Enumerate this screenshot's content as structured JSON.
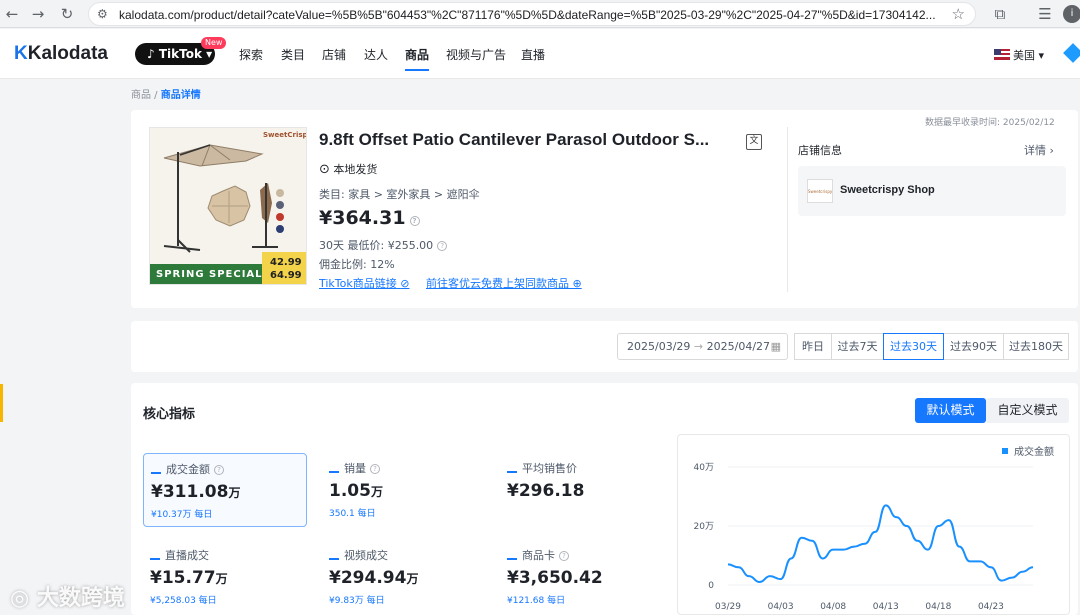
{
  "browser": {
    "url": "kalodata.com/product/detail?cateValue=%5B%5B\"604453\"%2C\"871176\"%5D%5D&dateRange=%5B\"2025-03-29\"%2C\"2025-04-27\"%5D&id=17304142...",
    "profile_initial": "i"
  },
  "nav": {
    "logo": "Kalodata",
    "platform": "TikTok",
    "new_badge": "New",
    "items": [
      "探索",
      "类目",
      "店铺",
      "达人",
      "商品",
      "视频与广告",
      "直播"
    ],
    "active": "商品",
    "region": "美国"
  },
  "breadcrumb": {
    "root": "商品",
    "sep": " / ",
    "current": "商品详情"
  },
  "product": {
    "title": "9.8ft Offset Patio Cantilever Parasol Outdoor S...",
    "ship_from": "本地发货",
    "category": "类目: 家具 > 室外家具 > 遮阳伞",
    "price": "¥364.31",
    "low_price": "30天 最低价: ¥255.00",
    "commission": "佣金比例: 12%",
    "link_tiktok": "TikTok商品链接",
    "link_list": "前往客优云免费上架同款商品",
    "image_banner": "SPRING SPECIAL",
    "image_price_1": "42.99",
    "image_price_2": "64.99",
    "image_brand": "SweetCrispy"
  },
  "shop": {
    "first_recorded": "数据最早收录时间: 2025/02/12",
    "section_title": "店铺信息",
    "details_link": "详情",
    "name": "Sweetcrispy Shop",
    "logo_text": "Sweetcrispy"
  },
  "date_filter": {
    "start": "2025/03/29",
    "arrow": "→",
    "end": "2025/04/27",
    "options": [
      "昨日",
      "过去7天",
      "过去30天",
      "过去90天",
      "过去180天"
    ],
    "active": "过去30天"
  },
  "core": {
    "title": "核心指标",
    "mode_default": "默认模式",
    "mode_custom": "自定义模式",
    "metrics": [
      {
        "label": "成交金额",
        "value": "¥311.08",
        "unit": "万",
        "sub": "¥10.37万 每日"
      },
      {
        "label": "销量",
        "value": "1.05",
        "unit": "万",
        "sub": "350.1 每日"
      },
      {
        "label": "平均销售价",
        "value": "¥296.18",
        "unit": "",
        "sub": ""
      },
      {
        "label": "直播成交",
        "value": "¥15.77",
        "unit": "万",
        "sub": "¥5,258.03 每日"
      },
      {
        "label": "视频成交",
        "value": "¥294.94",
        "unit": "万",
        "sub": "¥9.83万 每日"
      },
      {
        "label": "商品卡",
        "value": "¥3,650.42",
        "unit": "",
        "sub": "¥121.68 每日"
      }
    ]
  },
  "chart_data": {
    "type": "line",
    "series": [
      {
        "name": "成交金额",
        "color": "#1890ff"
      }
    ],
    "x": [
      "03/29",
      "03/30",
      "03/31",
      "04/01",
      "04/02",
      "04/03",
      "04/04",
      "04/05",
      "04/06",
      "04/07",
      "04/08",
      "04/09",
      "04/10",
      "04/11",
      "04/12",
      "04/13",
      "04/14",
      "04/15",
      "04/16",
      "04/17",
      "04/18",
      "04/19",
      "04/20",
      "04/21",
      "04/22",
      "04/23",
      "04/24",
      "04/25",
      "04/26",
      "04/27"
    ],
    "values": [
      7,
      6,
      3,
      1,
      3,
      2,
      9,
      16,
      15,
      9,
      12,
      12,
      13,
      14,
      18,
      27,
      23,
      20,
      15,
      12,
      20,
      22,
      13,
      8,
      8,
      6,
      1.5,
      2.5,
      4.5,
      6
    ],
    "y_ticks": [
      "40万",
      "20万",
      "0"
    ],
    "x_ticks": [
      "03/29",
      "04/03",
      "04/08",
      "04/13",
      "04/18",
      "04/23"
    ],
    "ylim": [
      0,
      40
    ],
    "unit": "万",
    "legend_position": "top-right",
    "grid": true
  },
  "watermark": "大数跨境"
}
